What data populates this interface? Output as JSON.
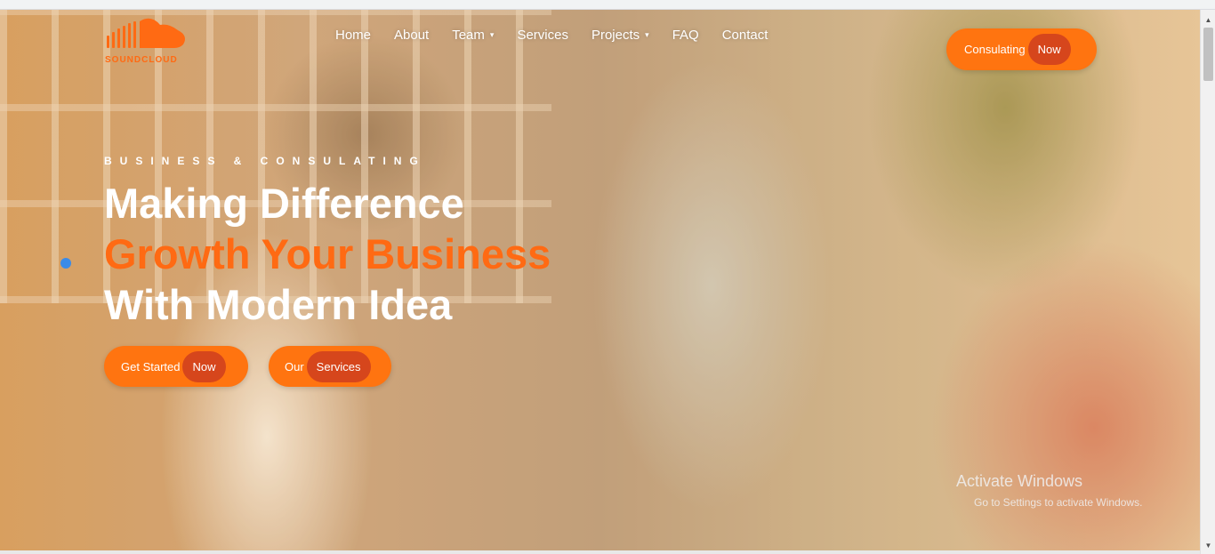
{
  "brand": {
    "logo_text": "SOUNDCLOUD",
    "logo_icon": "cloud-wave-icon"
  },
  "nav": {
    "items": [
      {
        "label": "Home",
        "dropdown": false
      },
      {
        "label": "About",
        "dropdown": false
      },
      {
        "label": "Team",
        "dropdown": true
      },
      {
        "label": "Services",
        "dropdown": false
      },
      {
        "label": "Projects",
        "dropdown": true
      },
      {
        "label": "FAQ",
        "dropdown": false
      },
      {
        "label": "Contact",
        "dropdown": false
      }
    ],
    "caret_icon": "▾"
  },
  "cta": {
    "label": "Consulating",
    "highlight": "Now"
  },
  "hero": {
    "eyebrow": "BUSINESS & CONSULATING",
    "line1": "Making Difference",
    "line2": "Growth Your Business",
    "line3": "With Modern Idea",
    "primary_btn": {
      "label": "Get Started",
      "highlight": "Now"
    },
    "secondary_btn": {
      "label": "Our",
      "highlight": "Services"
    }
  },
  "watermark": {
    "line1": "Activate Windows",
    "line2": "Go to Settings to activate Windows."
  },
  "colors": {
    "accent": "#ff7410",
    "accent_dark": "#d6461c",
    "headline_accent": "#ff6a13"
  },
  "scrollbar": {
    "up_icon": "▲",
    "down_icon": "▼"
  }
}
